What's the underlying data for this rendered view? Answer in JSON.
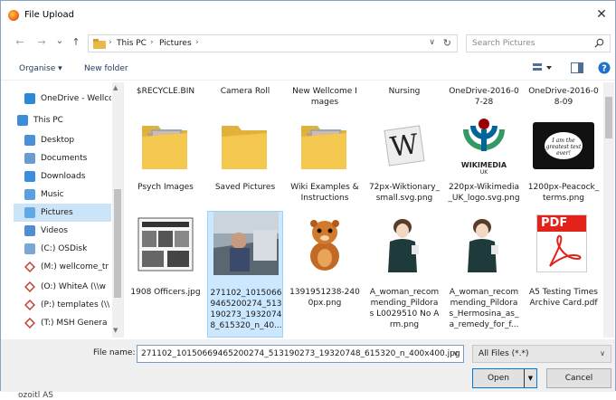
{
  "window": {
    "title": "File Upload",
    "close_glyph": "✕"
  },
  "nav": {
    "back_glyph": "←",
    "forward_glyph": "→",
    "recent_glyph": "⌄",
    "up_glyph": "↑",
    "breadcrumbs": [
      "This PC",
      "Pictures"
    ],
    "separator": "›",
    "dropdown_glyph": "∨",
    "refresh_glyph": "↻",
    "search_placeholder": "Search Pictures"
  },
  "toolbar": {
    "organise": "Organise ▾",
    "new_folder": "New folder"
  },
  "sidebar": {
    "items": [
      {
        "label": "OneDrive - Wellcc",
        "icon": "cloud-icon",
        "color": "#2b88d8"
      },
      {
        "label": "This PC",
        "icon": "computer-icon",
        "color": "#3c8fd6"
      },
      {
        "label": "Desktop",
        "icon": "desktop-icon",
        "color": "#4a90d9"
      },
      {
        "label": "Documents",
        "icon": "documents-icon",
        "color": "#6c9bd2"
      },
      {
        "label": "Downloads",
        "icon": "downloads-icon",
        "color": "#3a8ede"
      },
      {
        "label": "Music",
        "icon": "music-icon",
        "color": "#5aa0e0"
      },
      {
        "label": "Pictures",
        "icon": "pictures-icon",
        "color": "#62a8e5"
      },
      {
        "label": "Videos",
        "icon": "videos-icon",
        "color": "#4f8ed0"
      },
      {
        "label": "(C:) OSDisk",
        "icon": "disk-icon",
        "color": "#7aa8d6"
      },
      {
        "label": "(M:) wellcome_tr",
        "icon": "network-drive-icon",
        "color": "#c0392b"
      },
      {
        "label": "(O:) WhiteA (\\\\w",
        "icon": "network-drive-icon",
        "color": "#c0392b"
      },
      {
        "label": "(P:) templates (\\\\",
        "icon": "network-drive-icon",
        "color": "#c0392b"
      },
      {
        "label": "(T:) MSH Genera",
        "icon": "network-drive-icon",
        "color": "#c0392b"
      }
    ],
    "selected_index": 6,
    "scroll_up": "▲",
    "scroll_down": "▼"
  },
  "top_row": [
    "$RECYCLE.BIN",
    "Camera Roll",
    "New Wellcome Images",
    "Nursing",
    "OneDrive-2016-07-28",
    "OneDrive-2016-08-09"
  ],
  "row1": [
    {
      "label": "Psych Images",
      "kind": "folder-docs"
    },
    {
      "label": "Saved Pictures",
      "kind": "folder"
    },
    {
      "label": "Wiki Examples & Instructions",
      "kind": "folder-docs"
    },
    {
      "label": "72px-Wiktionary_small.svg.png",
      "kind": "wiktionary",
      "glyph": "W"
    },
    {
      "label": "220px-Wikimedia_UK_logo.svg.png",
      "kind": "wikimedia",
      "caption": "WIKIMEDIA",
      "sub": "UK"
    },
    {
      "label": "1200px-Peacock_terms.png",
      "kind": "peacock",
      "note": "I am the greatest text ever!"
    }
  ],
  "row2": [
    {
      "label": "1908 Officers.jpg",
      "kind": "newspaper"
    },
    {
      "label": "271102_10150669465200274_513190273_1932074 8_615320_n_40...",
      "kind": "photo"
    },
    {
      "label": "1391951238-2400px.png",
      "kind": "otter"
    },
    {
      "label": "A_woman_recommending_Pildora s L0029510 No Arm.png",
      "kind": "woman"
    },
    {
      "label": "A_woman_recommending_Pildora s_Hermosina_as_a_remedy_for_f...",
      "kind": "woman"
    },
    {
      "label": "A5 Testing Times Archive Card.pdf",
      "kind": "pdf",
      "glyph": "PDF"
    }
  ],
  "selected_tile": 1,
  "footer": {
    "filename_label": "File name:",
    "filename_value": "271102_10150669465200274_513190273_19320748_615320_n_400x400.jpg",
    "filetype_value": "All Files (*.*)",
    "open_label": "Open",
    "cancel_label": "Cancel",
    "drop_glyph": "∨",
    "split_glyph": "▼"
  },
  "behind_text": "ozoitl AS"
}
